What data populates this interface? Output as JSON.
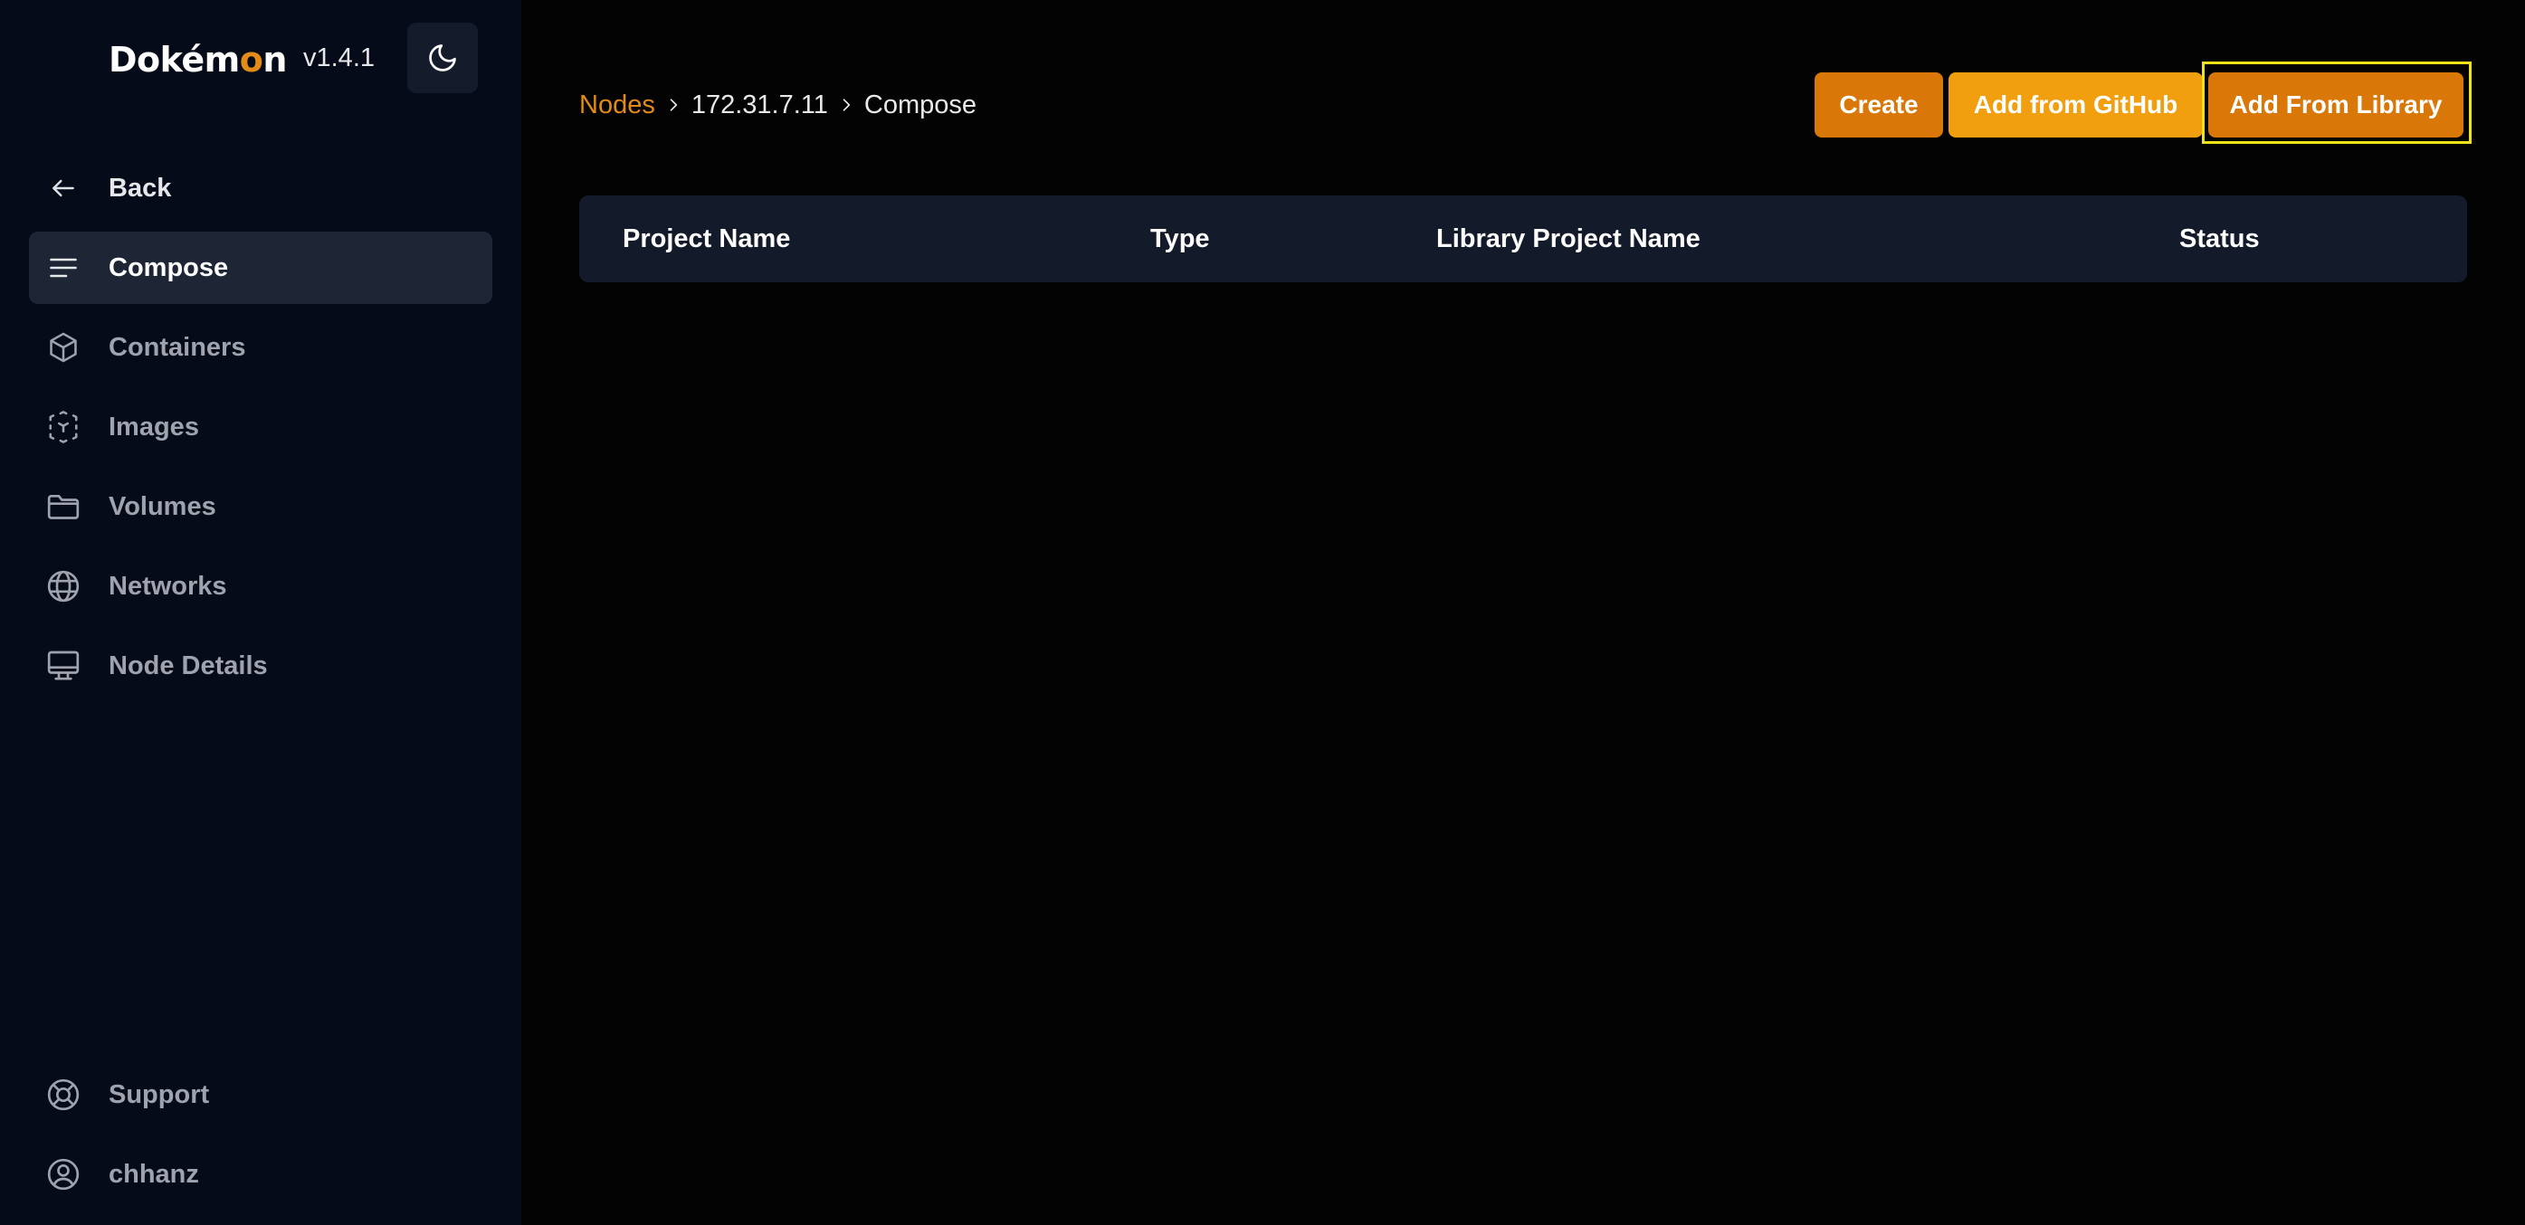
{
  "app": {
    "logo_text_pre": "Dokém",
    "logo_text_accent": "o",
    "logo_text_post": "n",
    "version": "v1.4.1"
  },
  "sidebar": {
    "back_label": "Back",
    "items": [
      {
        "label": "Compose",
        "icon": "menu-lines-icon",
        "active": true
      },
      {
        "label": "Containers",
        "icon": "cube-icon",
        "active": false
      },
      {
        "label": "Images",
        "icon": "dashed-cube-icon",
        "active": false
      },
      {
        "label": "Volumes",
        "icon": "folder-icon",
        "active": false
      },
      {
        "label": "Networks",
        "icon": "globe-icon",
        "active": false
      },
      {
        "label": "Node Details",
        "icon": "monitor-icon",
        "active": false
      }
    ],
    "footer": [
      {
        "label": "Support",
        "icon": "lifebuoy-icon"
      },
      {
        "label": "chhanz",
        "icon": "user-circle-icon"
      }
    ]
  },
  "breadcrumb": {
    "root": "Nodes",
    "node": "172.31.7.11",
    "current": "Compose"
  },
  "actions": {
    "create": "Create",
    "github": "Add from GitHub",
    "library": "Add From Library"
  },
  "table": {
    "columns": [
      "Project Name",
      "Type",
      "Library Project Name",
      "Status"
    ],
    "rows": []
  },
  "colors": {
    "accent": "#e48a16",
    "button_primary": "#d97808",
    "button_secondary": "#f19f0e",
    "sidebar_bg": "#050b18",
    "focus": "#f0e21a"
  }
}
